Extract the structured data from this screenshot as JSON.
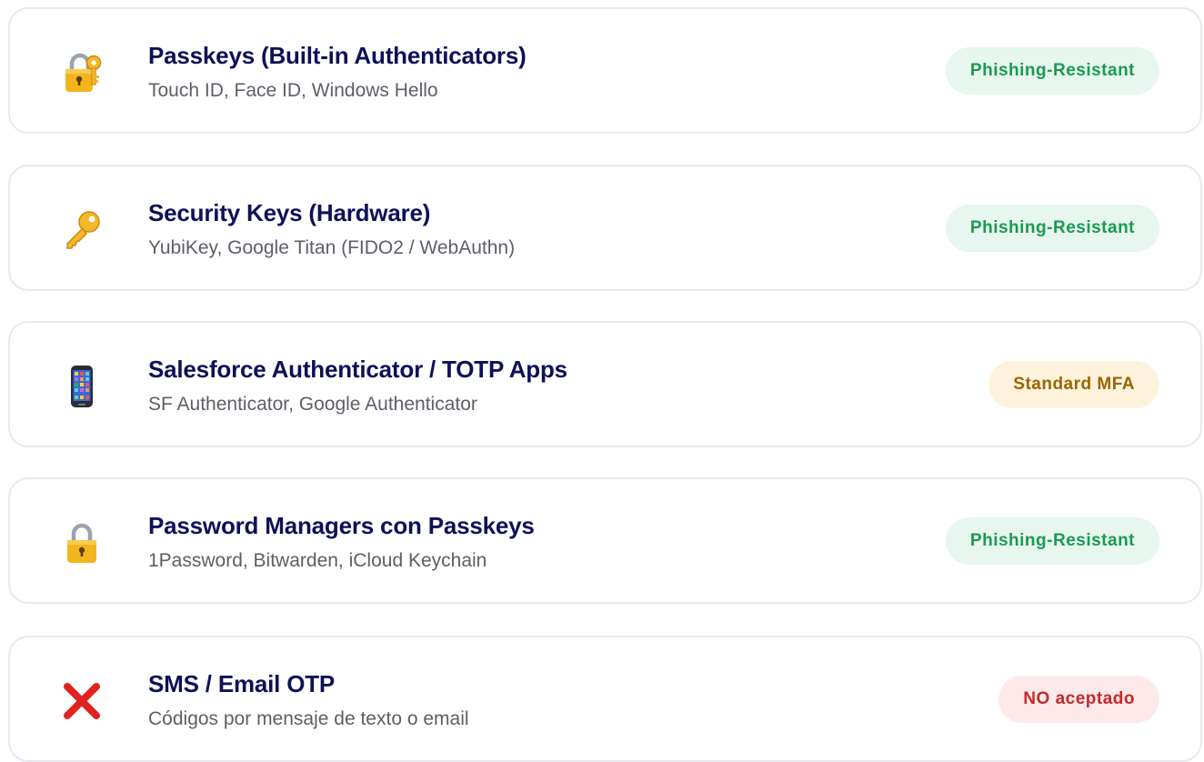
{
  "methods": [
    {
      "icon": "locked-with-key-icon",
      "title": "Passkeys (Built-in Authenticators)",
      "subtitle": "Touch ID, Face ID, Windows Hello",
      "badge": "Phishing-Resistant",
      "badge_color": "#1a9a52",
      "badge_bg": "#e7f6ee"
    },
    {
      "icon": "key-icon",
      "title": "Security Keys (Hardware)",
      "subtitle": "YubiKey, Google Titan (FIDO2 / WebAuthn)",
      "badge": "Phishing-Resistant",
      "badge_color": "#1a9a52",
      "badge_bg": "#e7f6ee"
    },
    {
      "icon": "mobile-phone-icon",
      "title": "Salesforce Authenticator / TOTP Apps",
      "subtitle": "SF Authenticator, Google Authenticator",
      "badge": "Standard MFA",
      "badge_color": "#9b6400",
      "badge_bg": "#fdf3dd"
    },
    {
      "icon": "padlock-icon",
      "title": "Password Managers con Passkeys",
      "subtitle": "1Password, Bitwarden, iCloud Keychain",
      "badge": "Phishing-Resistant",
      "badge_color": "#1a9a52",
      "badge_bg": "#e7f6ee"
    },
    {
      "icon": "cross-mark-icon",
      "title": "SMS / Email OTP",
      "subtitle": "Códigos por mensaje de texto o email",
      "badge": "NO aceptado",
      "badge_color": "#c6282b",
      "badge_bg": "#fde9e9"
    }
  ]
}
